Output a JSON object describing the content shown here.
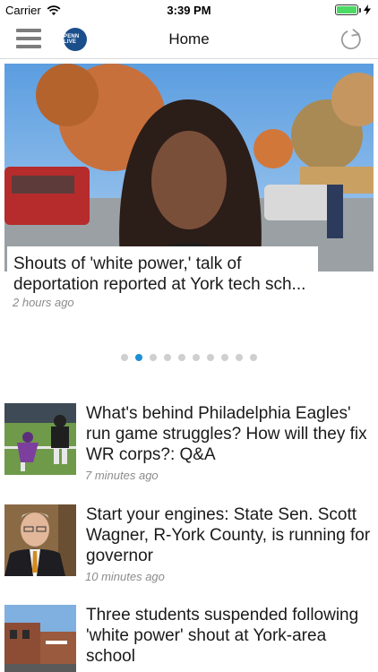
{
  "status_bar": {
    "carrier": "Carrier",
    "time": "3:39 PM",
    "battery_color": "#4cd964"
  },
  "nav": {
    "title": "Home",
    "logo_text": "PENN LIVE",
    "menu_icon": "hamburger-icon",
    "refresh_icon": "refresh-icon"
  },
  "hero": {
    "title": "Shouts of 'white power,' talk of deportation reported at York tech sch...",
    "time": "2 hours ago"
  },
  "pager": {
    "total": 10,
    "active_index": 1,
    "active_color": "#1f8fd6"
  },
  "articles": [
    {
      "title": "What's behind Philadelphia Eagles' run game struggles? How will they fix WR corps?: Q&A",
      "time": "7 minutes ago"
    },
    {
      "title": "Start your engines: State Sen. Scott Wagner, R-York County, is running for governor",
      "time": "10 minutes ago"
    },
    {
      "title": "Three students suspended following 'white power' shout at York-area school",
      "time": ""
    }
  ]
}
